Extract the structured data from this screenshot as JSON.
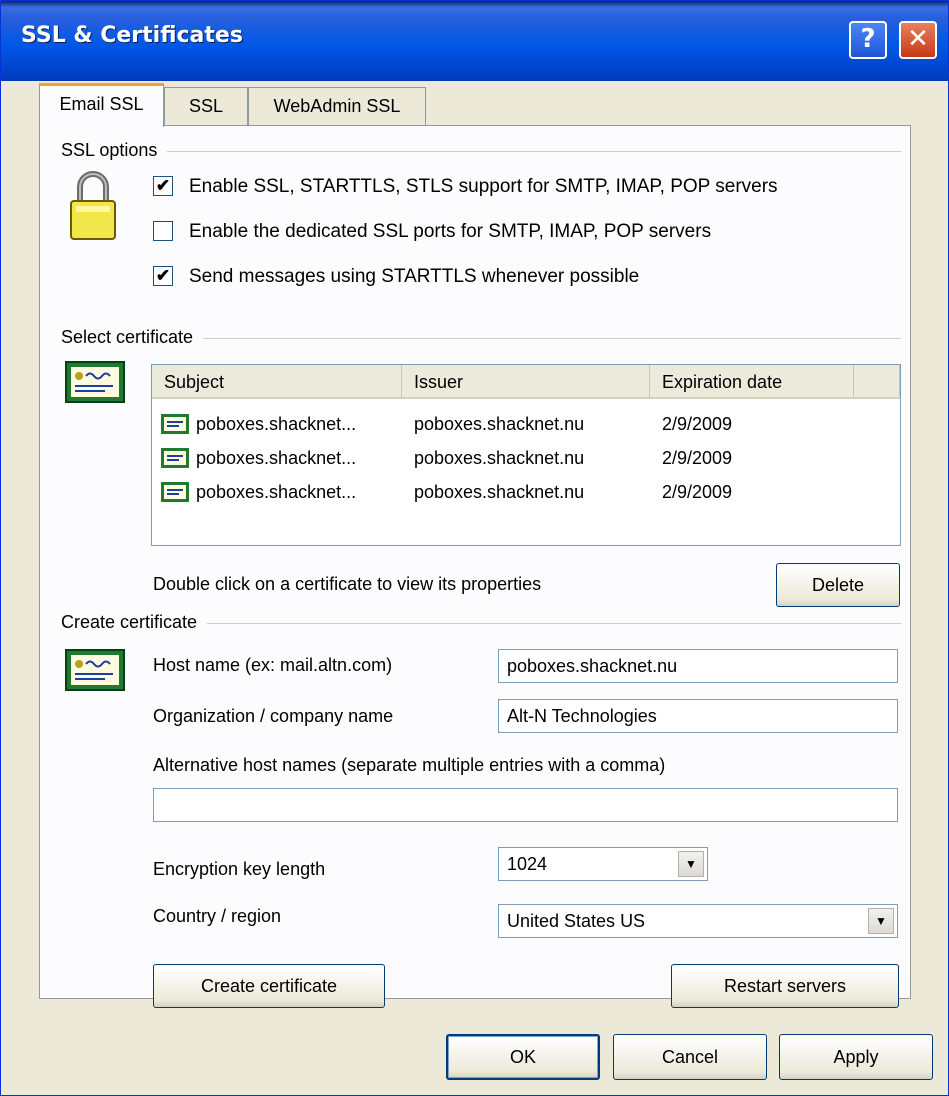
{
  "window": {
    "title": "SSL & Certificates",
    "help_label": "?",
    "close_label": "✕"
  },
  "tabs": [
    {
      "label": "Email SSL",
      "active": true
    },
    {
      "label": "SSL",
      "active": false
    },
    {
      "label": "WebAdmin SSL",
      "active": false
    }
  ],
  "ssl_options": {
    "group_label": "SSL options",
    "items": [
      {
        "label": "Enable SSL, STARTTLS, STLS support for SMTP, IMAP, POP servers",
        "checked": true
      },
      {
        "label": "Enable the dedicated SSL ports for SMTP, IMAP, POP servers",
        "checked": false
      },
      {
        "label": "Send messages using STARTTLS whenever possible",
        "checked": true
      }
    ]
  },
  "select_certificate": {
    "group_label": "Select certificate",
    "columns": [
      "Subject",
      "Issuer",
      "Expiration date"
    ],
    "rows": [
      {
        "subject": "poboxes.shacknet...",
        "issuer": "poboxes.shacknet.nu",
        "expiration": "2/9/2009"
      },
      {
        "subject": "poboxes.shacknet...",
        "issuer": "poboxes.shacknet.nu",
        "expiration": "2/9/2009"
      },
      {
        "subject": "poboxes.shacknet...",
        "issuer": "poboxes.shacknet.nu",
        "expiration": "2/9/2009"
      }
    ],
    "hint": "Double click on a certificate to view its properties",
    "delete_label": "Delete"
  },
  "create_certificate": {
    "group_label": "Create certificate",
    "host_label": "Host name (ex: mail.altn.com)",
    "host_value": "poboxes.shacknet.nu",
    "org_label": "Organization / company name",
    "org_value": "Alt-N Technologies",
    "alt_label": "Alternative host names (separate multiple entries with a comma)",
    "alt_value": "",
    "key_label": "Encryption key length",
    "key_value": "1024",
    "country_label": "Country / region",
    "country_value": "United States US",
    "create_label": "Create certificate",
    "restart_label": "Restart servers"
  },
  "footer": {
    "ok_label": "OK",
    "cancel_label": "Cancel",
    "apply_label": "Apply"
  },
  "icons": {
    "lock": "padlock-icon",
    "certificate": "certificate-icon",
    "dropdown": "chevron-down-icon"
  }
}
